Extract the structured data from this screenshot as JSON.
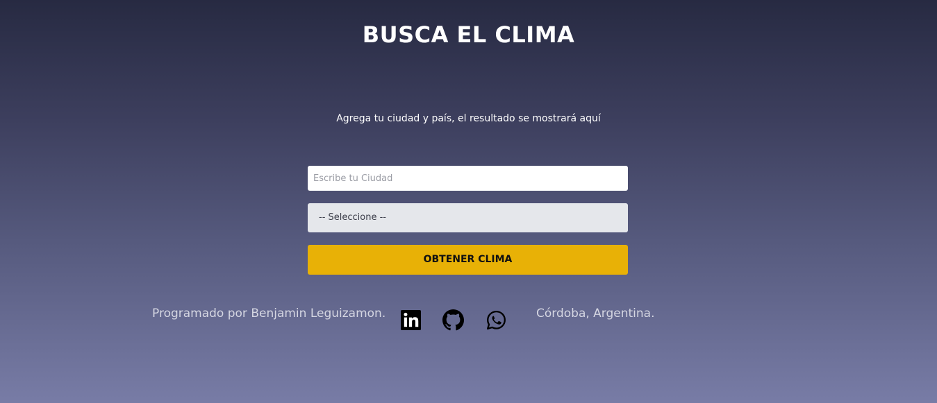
{
  "header": {
    "title": "BUSCA EL CLIMA"
  },
  "result": {
    "message": "Agrega tu ciudad y país, el resultado se mostrará aquí"
  },
  "form": {
    "city_placeholder": "Escribe tu Ciudad",
    "city_value": "",
    "country_selected": "-- Seleccione --",
    "submit_label": "OBTENER CLIMA"
  },
  "footer": {
    "author": "Programado por Benjamin Leguizamon.",
    "location": "Córdoba, Argentina.",
    "social_icons": [
      "linkedin-icon",
      "github-icon",
      "whatsapp-icon"
    ]
  },
  "colors": {
    "background_top": "#272a42",
    "background_bottom": "#787ca6",
    "button": "#e8b106",
    "select_bg": "#e5e7eb"
  }
}
